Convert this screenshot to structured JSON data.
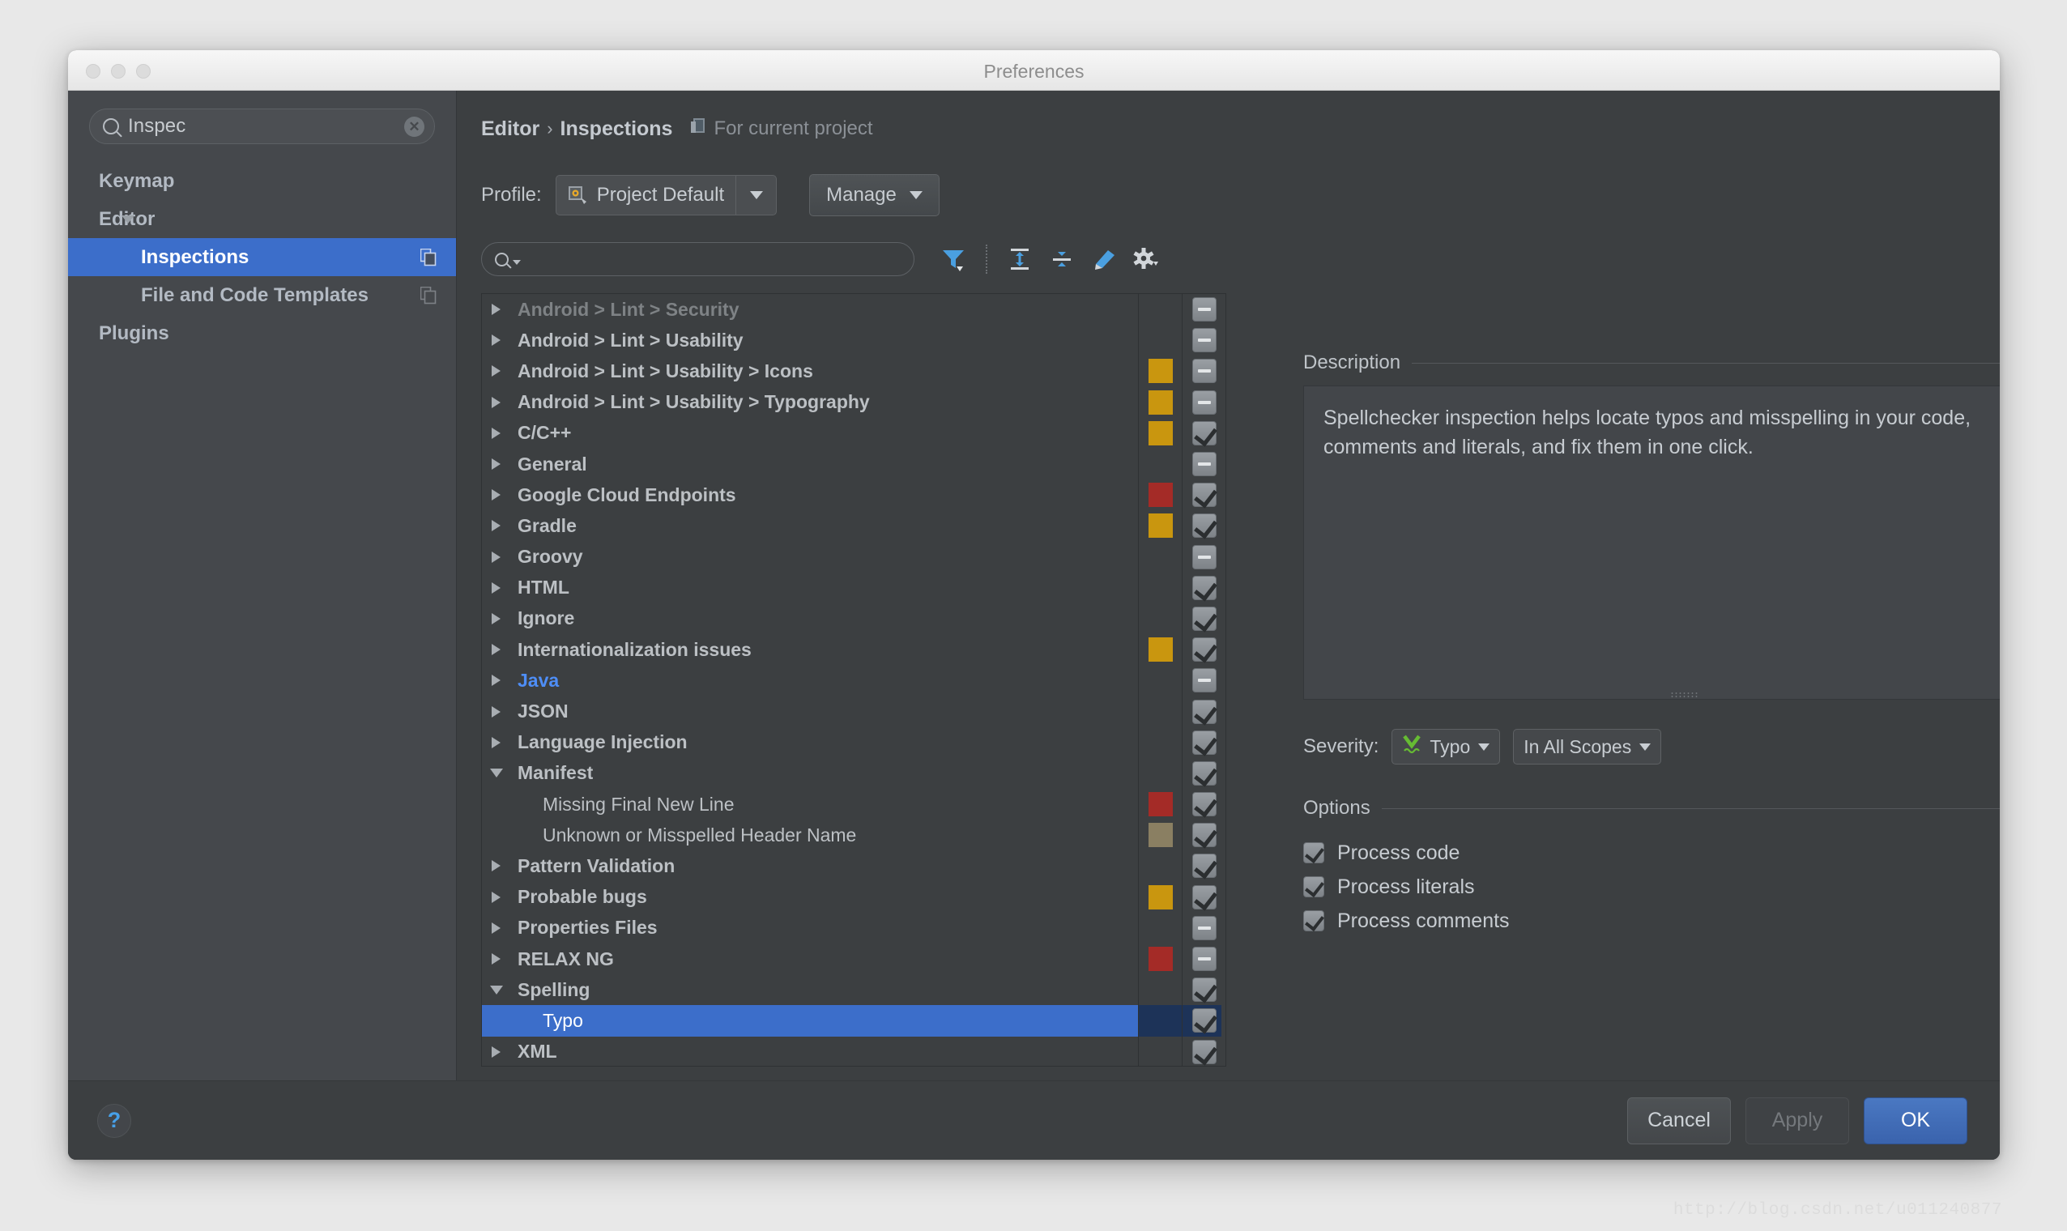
{
  "window": {
    "title": "Preferences",
    "traffic_lights": [
      "close",
      "minimize",
      "maximize"
    ]
  },
  "sidebar": {
    "search": {
      "value": "Inspec",
      "placeholder": "",
      "icon": "search-icon",
      "clear_icon": "clear-icon"
    },
    "items": [
      {
        "label": "Keymap",
        "level": "root",
        "expander": "none",
        "selected": false,
        "copy_icon": false
      },
      {
        "label": "Editor",
        "level": "root",
        "expander": "open",
        "selected": false,
        "copy_icon": false
      },
      {
        "label": "Inspections",
        "level": "child",
        "expander": "none",
        "selected": true,
        "copy_icon": true
      },
      {
        "label": "File and Code Templates",
        "level": "child",
        "expander": "none",
        "selected": false,
        "copy_icon": true
      },
      {
        "label": "Plugins",
        "level": "root",
        "expander": "none",
        "selected": false,
        "copy_icon": false
      }
    ]
  },
  "main": {
    "breadcrumb": {
      "root": "Editor",
      "separator": "›",
      "current": "Inspections",
      "scope_note": "For current project",
      "scope_icon": "project-icon"
    },
    "profile": {
      "label": "Profile:",
      "value": "Project Default",
      "icon": "profile-icon",
      "dropdown_icon": "chevron-down-icon",
      "manage_label": "Manage",
      "manage_icon": "chevron-down-icon"
    },
    "toolbar": {
      "search_placeholder": "",
      "search_value": "",
      "search_icon": "search-icon",
      "buttons": [
        {
          "name": "filter-icon",
          "tooltip": "Filter"
        },
        {
          "name": "expand-all-icon",
          "tooltip": "Expand All"
        },
        {
          "name": "collapse-all-icon",
          "tooltip": "Collapse All"
        },
        {
          "name": "reset-icon",
          "tooltip": "Reset"
        },
        {
          "name": "gear-icon",
          "tooltip": "Settings"
        }
      ]
    },
    "tree": {
      "rows": [
        {
          "label": "Android > Lint > Security",
          "type": "group",
          "expander": "closed",
          "severity": null,
          "checkbox": "dash",
          "selected": false,
          "clipped": true
        },
        {
          "label": "Android > Lint > Usability",
          "type": "group",
          "expander": "closed",
          "severity": null,
          "checkbox": "dash",
          "selected": false
        },
        {
          "label": "Android > Lint > Usability > Icons",
          "type": "group",
          "expander": "closed",
          "severity": "#c9960f",
          "checkbox": "dash",
          "selected": false
        },
        {
          "label": "Android > Lint > Usability > Typography",
          "type": "group",
          "expander": "closed",
          "severity": "#c9960f",
          "checkbox": "dash",
          "selected": false
        },
        {
          "label": "C/C++",
          "type": "group",
          "expander": "closed",
          "severity": "#c9960f",
          "checkbox": "tick",
          "selected": false
        },
        {
          "label": "General",
          "type": "group",
          "expander": "closed",
          "severity": null,
          "checkbox": "dash",
          "selected": false
        },
        {
          "label": "Google Cloud Endpoints",
          "type": "group",
          "expander": "closed",
          "severity": "#a42b27",
          "checkbox": "tick",
          "selected": false
        },
        {
          "label": "Gradle",
          "type": "group",
          "expander": "closed",
          "severity": "#c9960f",
          "checkbox": "tick",
          "selected": false
        },
        {
          "label": "Groovy",
          "type": "group",
          "expander": "closed",
          "severity": null,
          "checkbox": "dash",
          "selected": false
        },
        {
          "label": "HTML",
          "type": "group",
          "expander": "closed",
          "severity": null,
          "checkbox": "tick",
          "selected": false
        },
        {
          "label": "Ignore",
          "type": "group",
          "expander": "closed",
          "severity": null,
          "checkbox": "tick",
          "selected": false
        },
        {
          "label": "Internationalization issues",
          "type": "group",
          "expander": "closed",
          "severity": "#c9960f",
          "checkbox": "tick",
          "selected": false
        },
        {
          "label": "Java",
          "type": "group",
          "expander": "closed",
          "severity": null,
          "checkbox": "dash",
          "selected": false,
          "highlight": "#4e8ef7"
        },
        {
          "label": "JSON",
          "type": "group",
          "expander": "closed",
          "severity": null,
          "checkbox": "tick",
          "selected": false
        },
        {
          "label": "Language Injection",
          "type": "group",
          "expander": "closed",
          "severity": null,
          "checkbox": "tick",
          "selected": false
        },
        {
          "label": "Manifest",
          "type": "group",
          "expander": "open",
          "severity": null,
          "checkbox": "tick",
          "selected": false
        },
        {
          "label": "Missing Final New Line",
          "type": "leaf",
          "expander": "none",
          "severity": "#a42b27",
          "checkbox": "tick",
          "selected": false
        },
        {
          "label": "Unknown or Misspelled Header Name",
          "type": "leaf",
          "expander": "none",
          "severity": "#8a7f62",
          "checkbox": "tick",
          "selected": false
        },
        {
          "label": "Pattern Validation",
          "type": "group",
          "expander": "closed",
          "severity": null,
          "checkbox": "tick",
          "selected": false
        },
        {
          "label": "Probable bugs",
          "type": "group",
          "expander": "closed",
          "severity": "#c9960f",
          "checkbox": "tick",
          "selected": false
        },
        {
          "label": "Properties Files",
          "type": "group",
          "expander": "closed",
          "severity": null,
          "checkbox": "dash",
          "selected": false
        },
        {
          "label": "RELAX NG",
          "type": "group",
          "expander": "closed",
          "severity": "#a42b27",
          "checkbox": "dash",
          "selected": false
        },
        {
          "label": "Spelling",
          "type": "group",
          "expander": "open",
          "severity": null,
          "checkbox": "tick",
          "selected": false
        },
        {
          "label": "Typo",
          "type": "leaf",
          "expander": "none",
          "severity": null,
          "checkbox": "tick",
          "selected": true
        },
        {
          "label": "XML",
          "type": "group",
          "expander": "closed",
          "severity": null,
          "checkbox": "tick",
          "selected": false
        }
      ]
    }
  },
  "detail": {
    "description_title": "Description",
    "description_text": "Spellchecker inspection helps locate typos and misspelling in your code, comments and literals, and fix them in one click.",
    "severity_label": "Severity:",
    "severity_value": "Typo",
    "severity_icon": "typo-squiggle-icon",
    "scope_value": "In All Scopes",
    "options_title": "Options",
    "options": [
      {
        "label": "Process code",
        "checked": true
      },
      {
        "label": "Process literals",
        "checked": true
      },
      {
        "label": "Process comments",
        "checked": true
      }
    ]
  },
  "footer": {
    "help_label": "?",
    "cancel_label": "Cancel",
    "apply_label": "Apply",
    "ok_label": "OK"
  },
  "watermark": "http://blog.csdn.net/u011240877",
  "colors": {
    "accent": "#3c6eca",
    "warning": "#c9960f",
    "error": "#a42b27",
    "typo": "#8a7f62",
    "window_bg": "#3c3f41",
    "sidebar_bg": "#45484c"
  }
}
